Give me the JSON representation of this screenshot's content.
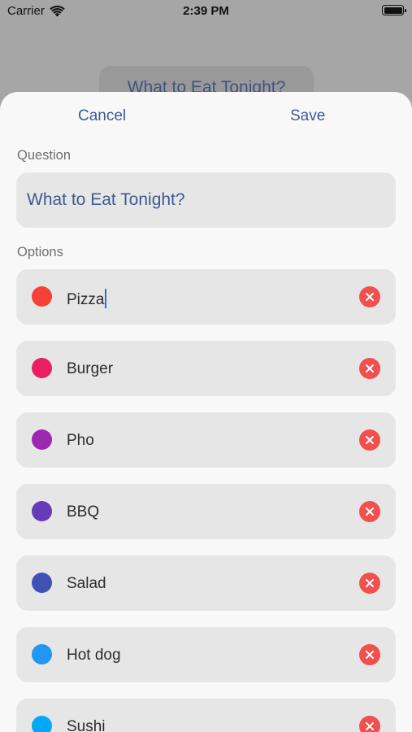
{
  "status_bar": {
    "carrier": "Carrier",
    "time": "2:39 PM"
  },
  "background": {
    "card_title": "What to Eat Tonight?"
  },
  "nav": {
    "cancel": "Cancel",
    "save": "Save"
  },
  "question": {
    "label": "Question",
    "value": "What to Eat Tonight?"
  },
  "options": {
    "label": "Options",
    "items": [
      {
        "text": "Pizza",
        "color": "#f44336"
      },
      {
        "text": "Burger",
        "color": "#e91e63"
      },
      {
        "text": "Pho",
        "color": "#9c27b0"
      },
      {
        "text": "BBQ",
        "color": "#673ab7"
      },
      {
        "text": "Salad",
        "color": "#3f51b5"
      },
      {
        "text": "Hot dog",
        "color": "#2196f3"
      },
      {
        "text": "Sushi",
        "color": "#03a9f4"
      }
    ]
  },
  "colors": {
    "accent": "#3e5a93",
    "remove": "#f1504f"
  },
  "icons": {
    "remove": "remove-x-icon",
    "wifi": "wifi-icon",
    "battery": "battery-icon"
  }
}
